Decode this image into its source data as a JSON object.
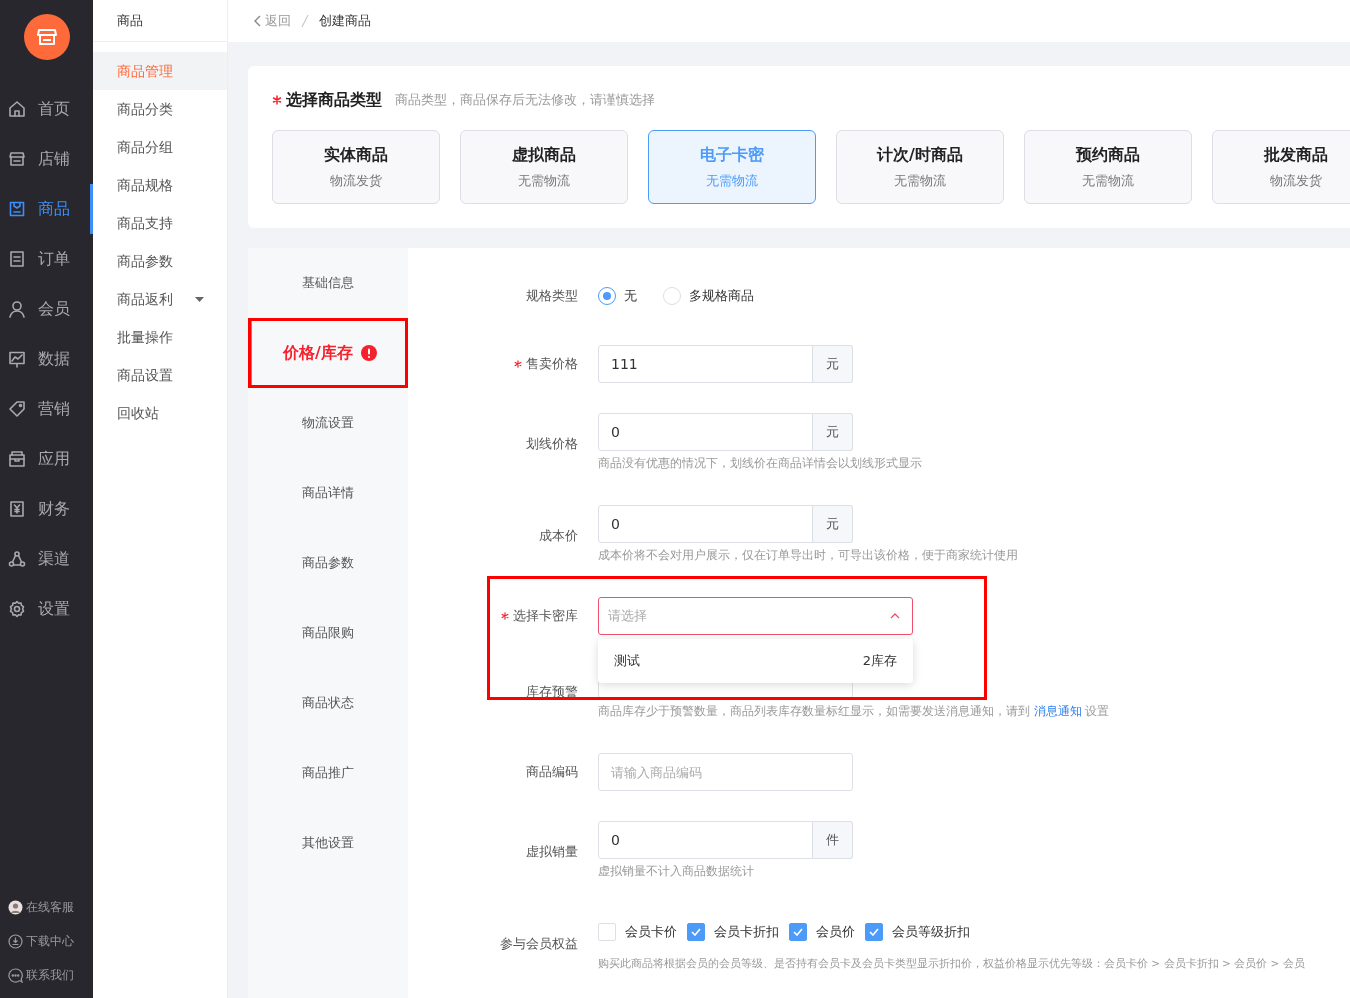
{
  "sidebar": {
    "items": [
      {
        "label": "首页",
        "selected": false
      },
      {
        "label": "店铺",
        "selected": false
      },
      {
        "label": "商品",
        "selected": true
      },
      {
        "label": "订单",
        "selected": false
      },
      {
        "label": "会员",
        "selected": false
      },
      {
        "label": "数据",
        "selected": false
      },
      {
        "label": "营销",
        "selected": false
      },
      {
        "label": "应用",
        "selected": false
      },
      {
        "label": "财务",
        "selected": false
      },
      {
        "label": "渠道",
        "selected": false
      },
      {
        "label": "设置",
        "selected": false
      }
    ],
    "footer": [
      {
        "label": "在线客服"
      },
      {
        "label": "下载中心"
      },
      {
        "label": "联系我们"
      }
    ]
  },
  "submenu": {
    "title": "商品",
    "items": [
      {
        "label": "商品管理",
        "selected": true,
        "expandable": false
      },
      {
        "label": "商品分类",
        "selected": false,
        "expandable": false
      },
      {
        "label": "商品分组",
        "selected": false,
        "expandable": false
      },
      {
        "label": "商品规格",
        "selected": false,
        "expandable": false
      },
      {
        "label": "商品支持",
        "selected": false,
        "expandable": false
      },
      {
        "label": "商品参数",
        "selected": false,
        "expandable": false
      },
      {
        "label": "商品返利",
        "selected": false,
        "expandable": true
      },
      {
        "label": "批量操作",
        "selected": false,
        "expandable": false
      },
      {
        "label": "商品设置",
        "selected": false,
        "expandable": false
      },
      {
        "label": "回收站",
        "selected": false,
        "expandable": false
      }
    ]
  },
  "breadcrumb": {
    "back": "返回",
    "current": "创建商品"
  },
  "type_section": {
    "title": "选择商品类型",
    "required": true,
    "hint": "商品类型，商品保存后无法修改，请谨慎选择",
    "types": [
      {
        "name": "实体商品",
        "sub": "物流发货",
        "selected": false
      },
      {
        "name": "虚拟商品",
        "sub": "无需物流",
        "selected": false
      },
      {
        "name": "电子卡密",
        "sub": "无需物流",
        "selected": true
      },
      {
        "name": "计次/时商品",
        "sub": "无需物流",
        "selected": false
      },
      {
        "name": "预约商品",
        "sub": "无需物流",
        "selected": false
      },
      {
        "name": "批发商品",
        "sub": "物流发货",
        "selected": false
      }
    ]
  },
  "form_tabs": [
    {
      "label": "基础信息",
      "selected": false,
      "error": false,
      "highlighted": false
    },
    {
      "label": "价格/库存",
      "selected": true,
      "error": true,
      "highlighted": true
    },
    {
      "label": "物流设置",
      "selected": false,
      "error": false,
      "highlighted": false
    },
    {
      "label": "商品详情",
      "selected": false,
      "error": false,
      "highlighted": false
    },
    {
      "label": "商品参数",
      "selected": false,
      "error": false,
      "highlighted": false
    },
    {
      "label": "商品限购",
      "selected": false,
      "error": false,
      "highlighted": false
    },
    {
      "label": "商品状态",
      "selected": false,
      "error": false,
      "highlighted": false
    },
    {
      "label": "商品推广",
      "selected": false,
      "error": false,
      "highlighted": false
    },
    {
      "label": "其他设置",
      "selected": false,
      "error": false,
      "highlighted": false
    }
  ],
  "form": [
    {
      "kind": "radio",
      "label": "规格类型",
      "required": false,
      "options": [
        {
          "label": "无",
          "selected": true
        },
        {
          "label": "多规格商品",
          "selected": false
        }
      ]
    },
    {
      "kind": "input",
      "label": "售卖价格",
      "required": true,
      "value": "111",
      "suffix": "元"
    },
    {
      "kind": "input",
      "label": "划线价格",
      "required": false,
      "value": "0",
      "suffix": "元",
      "hint": {
        "text": "商品没有优惠的情况下，划线价在商品详情会以划线形式显示"
      }
    },
    {
      "kind": "input",
      "label": "成本价",
      "required": false,
      "value": "0",
      "suffix": "元",
      "hint": {
        "text": "成本价将不会对用户展示，仅在订单导出时，可导出该价格，便于商家统计使用"
      }
    },
    {
      "kind": "select",
      "label": "选择卡密库",
      "required": true,
      "placeholder": "请选择",
      "expanded": true,
      "invalid": true,
      "highlighted": true,
      "options": [
        {
          "label": "测试",
          "stock": "2库存"
        }
      ]
    },
    {
      "kind": "input",
      "label": "库存预警",
      "required": false,
      "hint": {
        "text": "商品库存少于预警数量，商品列表库存数量标红显示，如需要发送消息通知，请到 ",
        "link": "消息通知",
        "after": " 设置"
      }
    },
    {
      "kind": "input",
      "label": "商品编码",
      "required": false,
      "placeholder": "请输入商品编码"
    },
    {
      "kind": "input",
      "label": "虚拟销量",
      "required": false,
      "value": "0",
      "suffix": "件",
      "hint": {
        "text": "虚拟销量不计入商品数据统计"
      }
    },
    {
      "kind": "checkboxes",
      "label": "参与会员权益",
      "required": false,
      "options": [
        {
          "label": "会员卡价",
          "checked": false
        },
        {
          "label": "会员卡折扣",
          "checked": true
        },
        {
          "label": "会员价",
          "checked": true
        },
        {
          "label": "会员等级折扣",
          "checked": true
        }
      ],
      "hint": {
        "text": "购买此商品将根据会员的会员等级、是否持有会员卡及会员卡类型显示折扣价，权益价格显示优先等级：会员卡价 > 会员卡折扣 > 会员价 > 会员"
      }
    }
  ]
}
